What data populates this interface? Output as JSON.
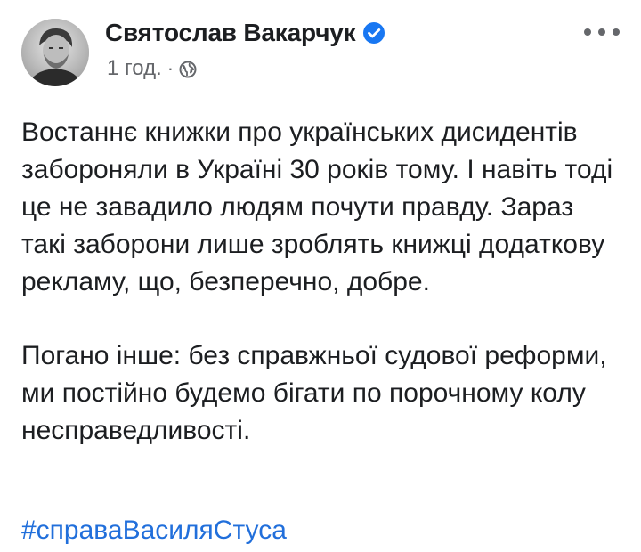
{
  "post": {
    "author": "Святослав Вакарчук",
    "time": "1 год.",
    "separator": "·",
    "paragraphs": [
      "Востаннє книжки про українських дисидентів забороняли в Україні 30 років тому. І навіть тоді це не завадило людям почути правду. Зараз такі заборони лише зроблять книжці додаткову рекламу, що, безперечно, добре.",
      "Погано інше: без справжньої судової реформи, ми постійно будемо бігати по порочному колу несправедливості."
    ],
    "hashtag": "#справаВасиляСтуса"
  },
  "icons": {
    "verified": "verified-badge-icon",
    "audience": "globe-icon",
    "menu": "more-options-icon"
  },
  "colors": {
    "text": "#1c1e21",
    "secondary": "#65676b",
    "link": "#216fdb",
    "verified": "#1877f2"
  }
}
